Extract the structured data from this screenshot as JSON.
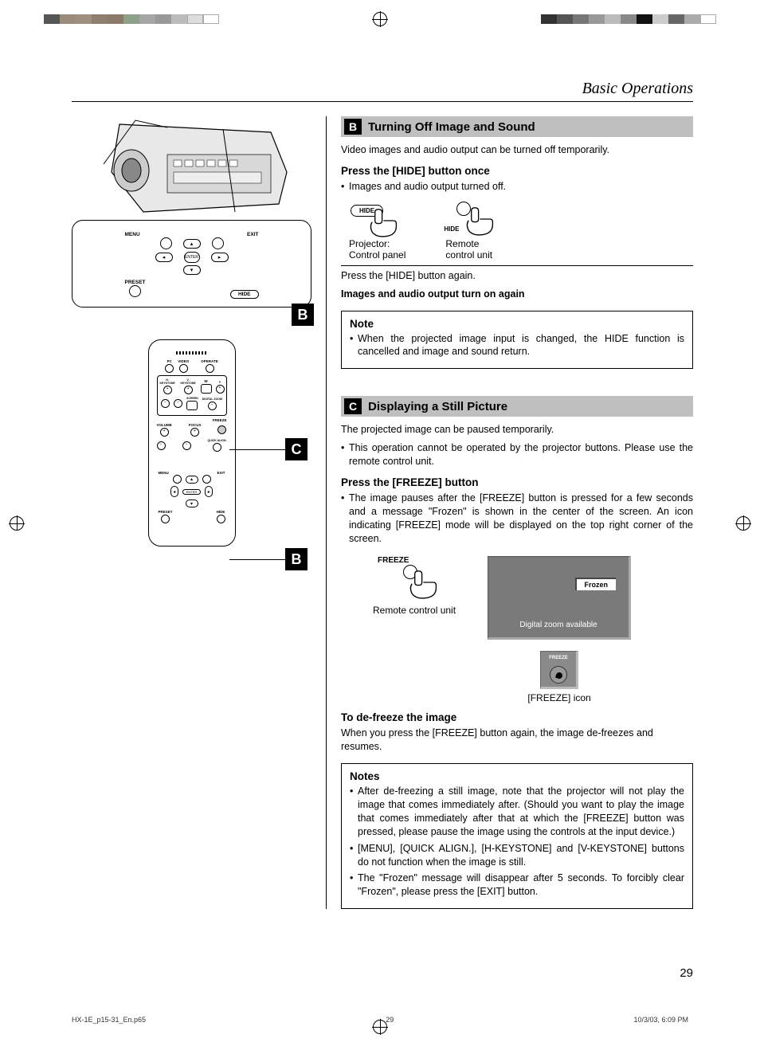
{
  "header": {
    "title": "Basic Operations"
  },
  "sectionB": {
    "marker": "B",
    "title": "Turning Off Image and Sound",
    "intro": "Video images and audio output can be turned off temporarily.",
    "press_head": "Press the [HIDE] button once",
    "press_bullet": "Images and audio output turned off.",
    "hide_label": "HIDE",
    "projector_caption1": "Projector:",
    "projector_caption2": "Control panel",
    "remote_caption1": "Remote",
    "remote_caption2": "control unit",
    "press_again": "Press the [HIDE] button again.",
    "turn_on": "Images and audio output turn on again",
    "note_title": "Note",
    "note_bullet": "When the projected image input is changed, the HIDE function is cancelled and image and sound return."
  },
  "sectionC": {
    "marker": "C",
    "title": "Displaying a Still Picture",
    "intro": "The projected image can be paused temporarily.",
    "intro_bullet": "This operation cannot be operated by the projector buttons. Please use the remote control unit.",
    "press_head": "Press the [FREEZE] button",
    "press_bullet": "The image pauses after the [FREEZE] button is pressed for a few seconds and a message \"Frozen\" is shown in the center of the screen. An icon indicating [FREEZE] mode will be displayed on the top right corner of the screen.",
    "freeze_label": "FREEZE",
    "remote_caption": "Remote control unit",
    "frozen_badge": "Frozen",
    "frozen_subtext": "Digital zoom available",
    "freeze_icon_caption": "[FREEZE] icon",
    "defreeze_head": "To de-freeze the image",
    "defreeze_text": "When you press the [FREEZE] button again, the image de-freezes and resumes.",
    "notes_title": "Notes",
    "notes": [
      "After de-freezing a still image, note that the projector will not play the image that comes immediately after. (Should you want to play the image that comes immediately after that at which the [FREEZE] button was pressed, please pause the image using the controls at the input device.)",
      "[MENU], [QUICK ALIGN.], [H-KEYSTONE] and [V-KEYSTONE] buttons do not function when the image is still.",
      "The \"Frozen\" message will disappear after 5 seconds. To forcibly clear \"Frozen\", please press the [EXIT] button."
    ]
  },
  "panel_labels": {
    "menu": "MENU",
    "exit": "EXIT",
    "enter": "ENTER",
    "preset": "PRESET",
    "hide": "HIDE"
  },
  "remote_labels": {
    "top": [
      "PC",
      "VIDEO",
      "OPERATE"
    ],
    "row2": [
      "H-KEYSTONE",
      "V-KEYSTONE",
      "W",
      "+"
    ],
    "row3": [
      "",
      "",
      "SCREEN",
      "DIGITAL ZOOM"
    ],
    "freeze": "FREEZE",
    "volume": "VOLUME",
    "focus": "FOCUS",
    "quick": "QUICK ALIGN.",
    "menu": "MENU",
    "exit": "EXIT",
    "preset": "PRESET",
    "hide": "HIDE",
    "enter": "ENTER"
  },
  "callouts": {
    "B": "B",
    "C": "C"
  },
  "page_number": "29",
  "footer": {
    "file": "HX-1E_p15-31_En.p65",
    "page": "29",
    "date": "10/3/03, 6:09 PM"
  }
}
